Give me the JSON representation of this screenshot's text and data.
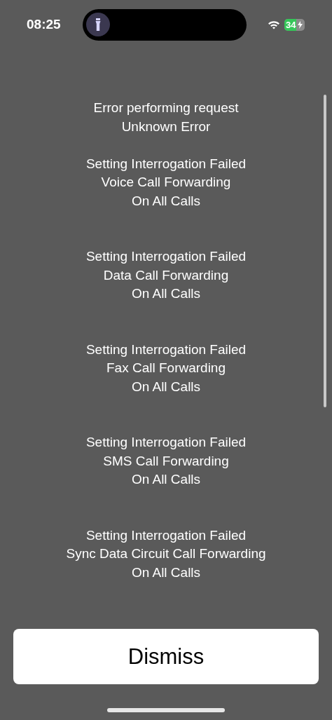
{
  "status_bar": {
    "time": "08:25",
    "battery": "34"
  },
  "messages": [
    {
      "lines": [
        "Error performing request",
        "Unknown Error"
      ]
    },
    {
      "lines": [
        "Setting Interrogation Failed",
        "Voice Call Forwarding",
        "On All Calls"
      ]
    },
    {
      "lines": [
        "Setting Interrogation Failed",
        "Data Call Forwarding",
        "On All Calls"
      ]
    },
    {
      "lines": [
        "Setting Interrogation Failed",
        "Fax Call Forwarding",
        "On All Calls"
      ]
    },
    {
      "lines": [
        "Setting Interrogation Failed",
        "SMS Call Forwarding",
        "On All Calls"
      ]
    },
    {
      "lines": [
        "Setting Interrogation Failed",
        "Sync Data Circuit Call Forwarding",
        "On All Calls"
      ]
    }
  ],
  "button": {
    "label": "Dismiss"
  }
}
